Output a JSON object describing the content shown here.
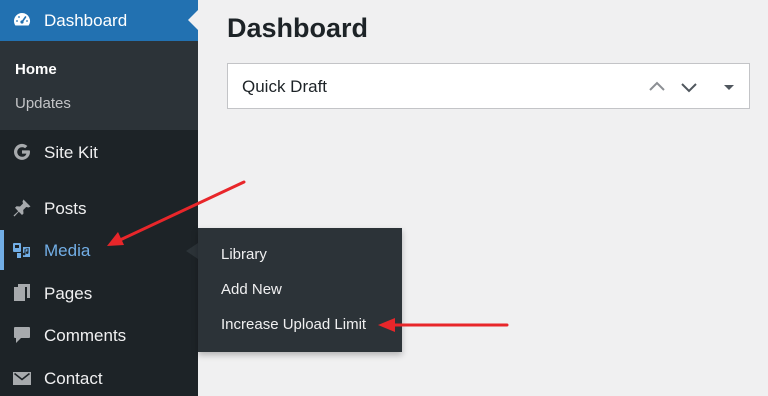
{
  "sidebar": {
    "dashboard": {
      "label": "Dashboard",
      "icon": "dashboard-gauge-icon"
    },
    "submenu": {
      "home": "Home",
      "updates": "Updates"
    },
    "items": [
      {
        "id": "sitekit",
        "label": "Site Kit",
        "icon": "google-g-icon"
      },
      {
        "id": "posts",
        "label": "Posts",
        "icon": "pushpin-icon"
      },
      {
        "id": "media",
        "label": "Media",
        "icon": "media-icon",
        "active": true
      },
      {
        "id": "pages",
        "label": "Pages",
        "icon": "pages-icon"
      },
      {
        "id": "comments",
        "label": "Comments",
        "icon": "comment-bubble-icon"
      },
      {
        "id": "contact",
        "label": "Contact",
        "icon": "envelope-icon"
      }
    ]
  },
  "media_flyout": {
    "items": [
      "Library",
      "Add New",
      "Increase Upload Limit"
    ]
  },
  "main": {
    "title": "Dashboard",
    "widget": {
      "title": "Quick Draft",
      "controls": [
        "move-up-icon",
        "move-down-icon",
        "toggle-panel-icon"
      ]
    }
  },
  "colors": {
    "sidebar_bg": "#1d2327",
    "submenu_bg": "#2c3338",
    "active_blue": "#2271b1",
    "media_highlight": "#72aee6",
    "annotation_red": "#e8262a",
    "page_bg": "#f0f0f1"
  }
}
